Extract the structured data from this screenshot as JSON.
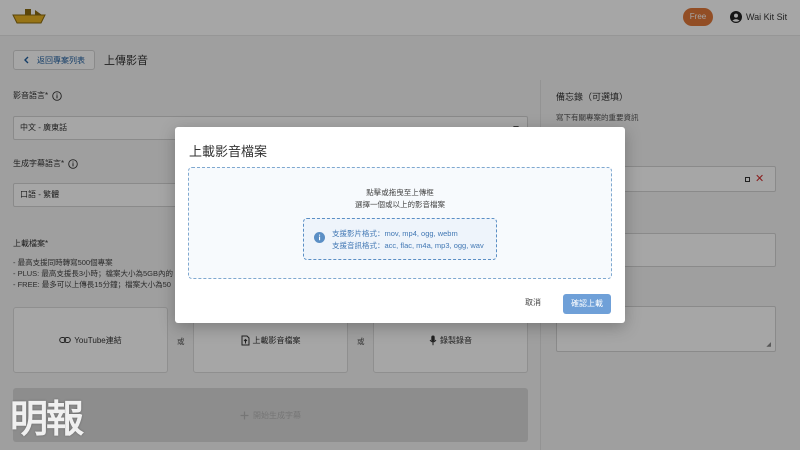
{
  "header": {
    "logo_icon": "boat-logo-icon",
    "plan_badge": "Free",
    "user_icon": "account-circle-icon",
    "user_name": "Wai Kit Sit"
  },
  "page": {
    "back_label": "返回專案列表",
    "back_icon": "chevron-left-icon",
    "title": "上傳影音"
  },
  "form": {
    "media_language_label": "影音語言*",
    "media_language_value": "中文 - 廣東話",
    "subtitle_language_label": "生成字幕語言*",
    "subtitle_language_value": "口語 - 繁體",
    "upload_label": "上載檔案*",
    "limits": [
      "- 最高支援同時轉寫500個專案",
      "- PLUS: 最高支援長3小時；檔案大小為5GB內的",
      "- FREE: 最多可以上傳長15分鐘；檔案大小為50"
    ],
    "or_text": "或",
    "sources": [
      {
        "label": "YouTube連結",
        "icon": "link-icon"
      },
      {
        "label": "上載影音檔案",
        "icon": "file-upload-icon"
      },
      {
        "label": "錄製錄音",
        "icon": "microphone-icon"
      }
    ],
    "generate_label": "開始生成字幕",
    "generate_icon": "plus-icon"
  },
  "notes": {
    "title": "備忘錄（可選填）",
    "subtitle": "寫下有關專案的重要資訊"
  },
  "modal": {
    "title": "上載影音檔案",
    "drop_line1": "點擊或拖曳至上傳框",
    "drop_line2": "選擇一個或以上的影音檔案",
    "info_icon": "info-icon",
    "video_formats": "支援影片格式：mov, mp4, ogg, webm",
    "audio_formats": "支援音訊格式：acc, flac, m4a, mp3, ogg, wav",
    "cancel_label": "取消",
    "confirm_label": "確認上載"
  },
  "watermark": "明報",
  "colors": {
    "accent": "#e0793a",
    "link": "#1f5fa0",
    "primary_button": "#6fa0d8",
    "danger": "#d32f2f"
  }
}
